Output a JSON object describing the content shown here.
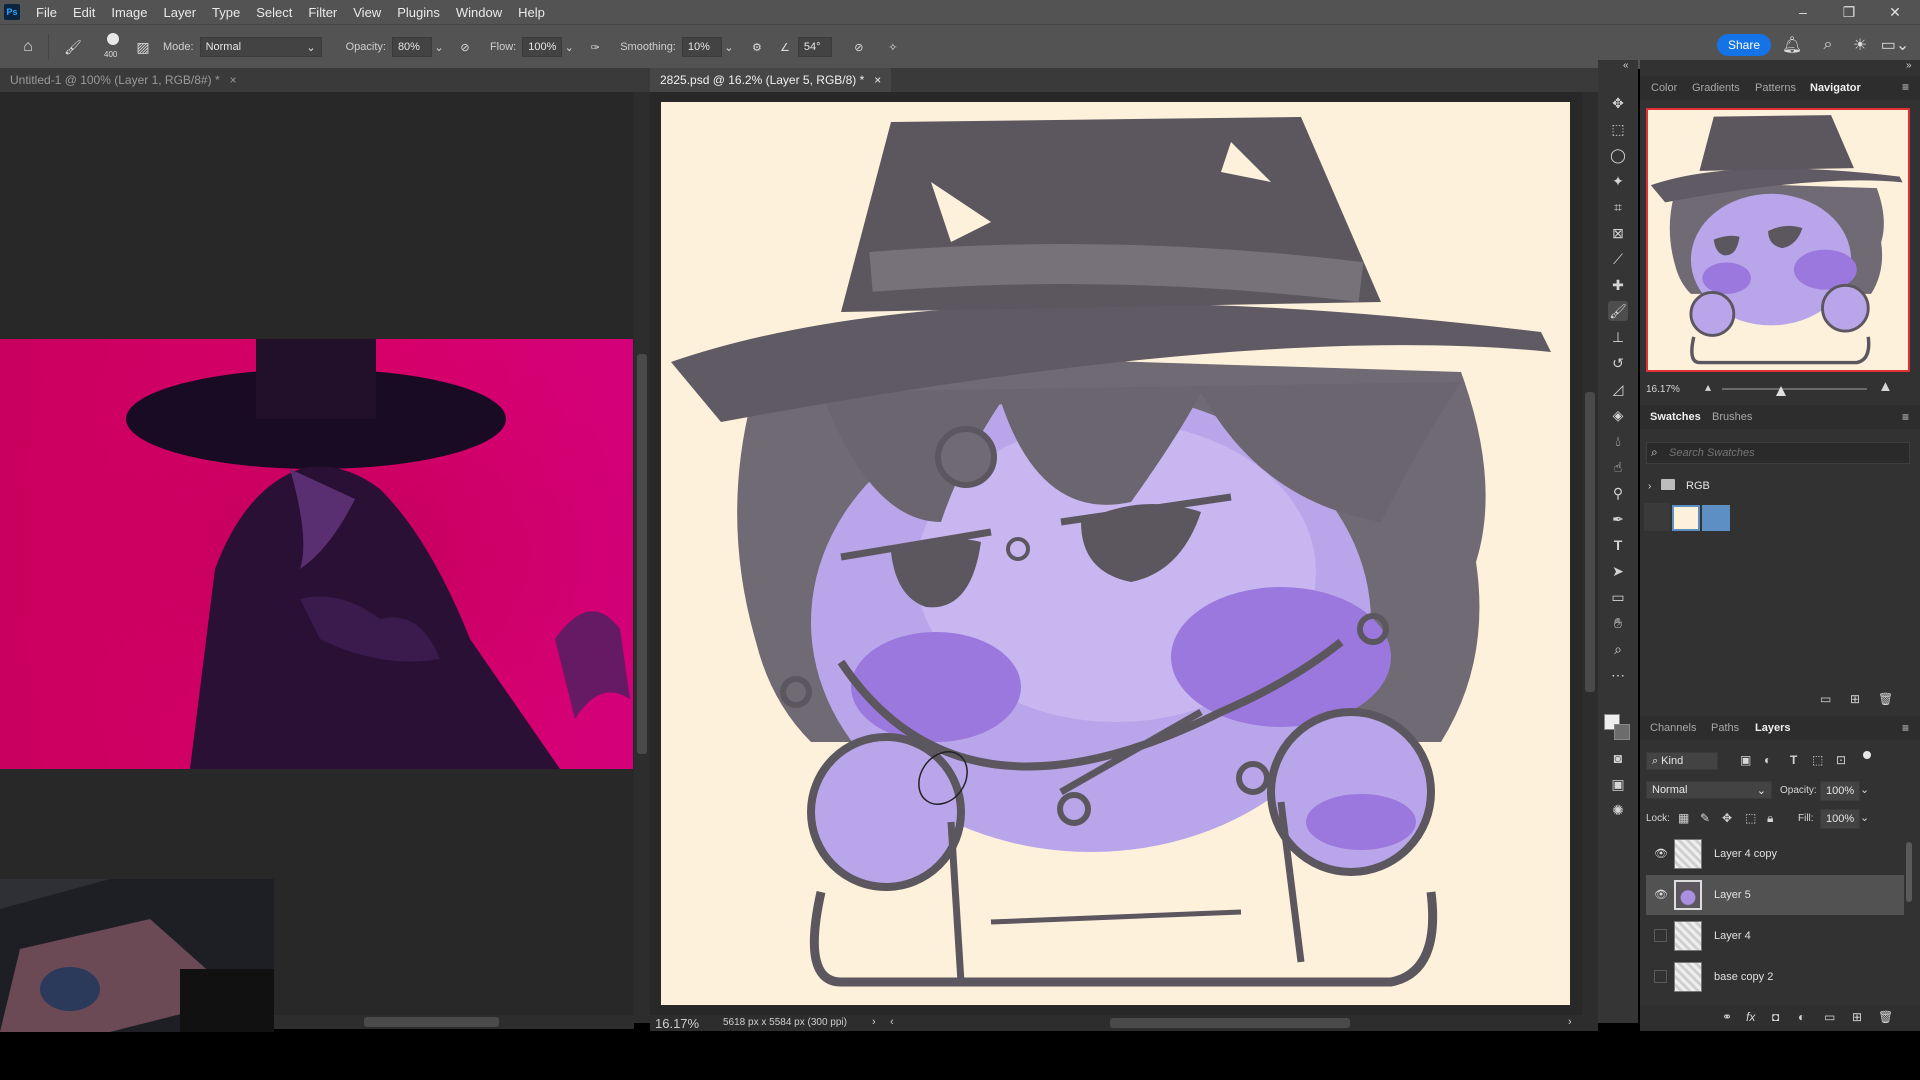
{
  "app": {
    "logo": "Ps"
  },
  "menu": [
    "File",
    "Edit",
    "Image",
    "Layer",
    "Type",
    "Select",
    "Filter",
    "View",
    "Plugins",
    "Window",
    "Help"
  ],
  "window_controls": {
    "minimize": "–",
    "restore": "❐",
    "close": "✕"
  },
  "options": {
    "brush_size": "400",
    "mode_label": "Mode:",
    "mode_value": "Normal",
    "opacity_label": "Opacity:",
    "opacity_value": "80%",
    "flow_label": "Flow:",
    "flow_value": "100%",
    "smoothing_label": "Smoothing:",
    "smoothing_value": "10%",
    "angle_value": "54°",
    "share_label": "Share"
  },
  "tabs": {
    "left_doc": "Untitled-1 @ 100% (Layer 1, RGB/8#) *",
    "right_doc": "2825.psd @ 16.2% (Layer 5, RGB/8) *",
    "close": "×"
  },
  "status": {
    "zoom": "16.17%",
    "doc_info": "5618 px x 5584 px (300 ppi)"
  },
  "panel_top": {
    "tabs": [
      "Color",
      "Gradients",
      "Patterns",
      "Navigator"
    ],
    "active": "Navigator",
    "navigator_zoom": "16.17%"
  },
  "swatches": {
    "tabs": [
      "Swatches",
      "Brushes"
    ],
    "search_placeholder": "Search Swatches",
    "group_name": "RGB",
    "colors": [
      "#fdf1dc",
      "#5d8fc4"
    ]
  },
  "layers_panel": {
    "tabs": [
      "Channels",
      "Paths",
      "Layers"
    ],
    "filter_kind": "Kind",
    "blend_mode": "Normal",
    "opacity_label": "Opacity:",
    "opacity_value": "100%",
    "lock_label": "Lock:",
    "fill_label": "Fill:",
    "fill_value": "100%",
    "layers": [
      {
        "name": "Layer 4 copy",
        "visible": true,
        "selected": false
      },
      {
        "name": "Layer 5",
        "visible": true,
        "selected": true
      },
      {
        "name": "Layer 4",
        "visible": false,
        "selected": false
      },
      {
        "name": "base copy 2",
        "visible": false,
        "selected": false
      }
    ]
  },
  "colors": {
    "canvas_bg": "#fdf1dc",
    "accent": "#1473e6",
    "sketch_gray": "#5c575e",
    "sketch_purple": "#a990e0",
    "reference_magenta": "#d20070"
  }
}
